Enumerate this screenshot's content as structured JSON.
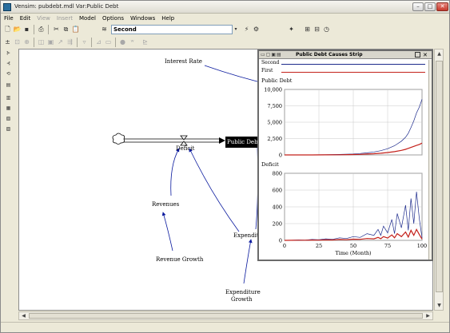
{
  "window": {
    "title": "Vensim: pubdebt.mdl Var:Public Debt"
  },
  "menu": [
    {
      "label": "File",
      "enabled": true
    },
    {
      "label": "Edit",
      "enabled": true
    },
    {
      "label": "View",
      "enabled": false
    },
    {
      "label": "Insert",
      "enabled": false
    },
    {
      "label": "Model",
      "enabled": true
    },
    {
      "label": "Options",
      "enabled": true
    },
    {
      "label": "Windows",
      "enabled": true
    },
    {
      "label": "Help",
      "enabled": true
    }
  ],
  "toolbar": {
    "simulation_name": "Second"
  },
  "diagram": {
    "labels": {
      "interest_rate": "Interest Rate",
      "deficit": "Deficit",
      "public_debt": "Public Debt",
      "revenues": "Revenues",
      "revenue_growth": "Revenue Growth",
      "expenditures": "Expendit",
      "expenditure_growth_line1": "Expenditure",
      "expenditure_growth_line2": "Growth"
    }
  },
  "strip": {
    "title": "Public Debt Causes Strip",
    "legend": [
      {
        "name": "Second",
        "color": "#1c2a8c"
      },
      {
        "name": "First",
        "color": "#c4201a"
      }
    ],
    "x_label": "Time (Month)"
  },
  "chart_data": [
    {
      "type": "line",
      "title": "Public Debt",
      "xlabel": "Time (Month)",
      "ylabel": "",
      "xlim": [
        0,
        100
      ],
      "ylim": [
        0,
        10000
      ],
      "x_ticks": [
        "0",
        "25",
        "50",
        "75",
        "100"
      ],
      "y_ticks": [
        "10,000",
        "7,500",
        "5,000",
        "2,500",
        "0"
      ],
      "grid": true,
      "x": [
        0,
        10,
        20,
        30,
        40,
        50,
        55,
        60,
        65,
        70,
        75,
        80,
        85,
        88,
        90,
        92,
        94,
        96,
        98,
        100
      ],
      "series": [
        {
          "name": "Second",
          "values": [
            0,
            0,
            10,
            40,
            80,
            150,
            220,
            320,
            450,
            650,
            950,
            1400,
            2100,
            2700,
            3300,
            4200,
            5200,
            6400,
            7300,
            8500
          ]
        },
        {
          "name": "First",
          "values": [
            0,
            0,
            5,
            15,
            30,
            60,
            90,
            130,
            180,
            260,
            360,
            500,
            700,
            850,
            1000,
            1150,
            1300,
            1450,
            1600,
            1800
          ]
        }
      ]
    },
    {
      "type": "line",
      "title": "Deficit",
      "xlabel": "Time (Month)",
      "ylabel": "",
      "xlim": [
        0,
        100
      ],
      "ylim": [
        0,
        800
      ],
      "x_ticks": [
        "0",
        "25",
        "50",
        "75",
        "100"
      ],
      "y_ticks": [
        "800",
        "600",
        "400",
        "200",
        "0"
      ],
      "grid": true,
      "x": [
        0,
        5,
        10,
        15,
        20,
        25,
        30,
        35,
        40,
        45,
        50,
        55,
        60,
        65,
        68,
        70,
        72,
        75,
        78,
        80,
        82,
        85,
        88,
        90,
        92,
        94,
        96,
        98,
        100
      ],
      "series": [
        {
          "name": "Second",
          "values": [
            0,
            2,
            5,
            3,
            10,
            8,
            18,
            12,
            30,
            22,
            45,
            35,
            80,
            60,
            130,
            60,
            170,
            90,
            250,
            80,
            320,
            150,
            420,
            120,
            500,
            200,
            580,
            260,
            30
          ]
        },
        {
          "name": "First",
          "values": [
            0,
            1,
            2,
            2,
            4,
            3,
            6,
            5,
            10,
            8,
            14,
            12,
            22,
            18,
            35,
            20,
            45,
            28,
            65,
            30,
            80,
            45,
            100,
            40,
            120,
            60,
            130,
            70,
            15
          ]
        }
      ]
    }
  ]
}
